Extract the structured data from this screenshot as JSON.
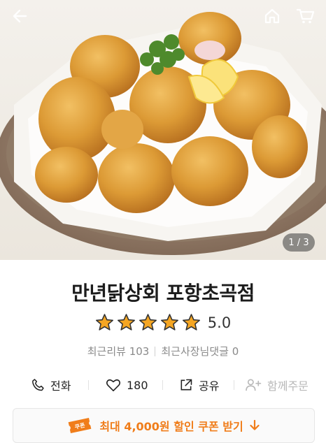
{
  "hero": {
    "pager": "1 / 3"
  },
  "topbar": {
    "icons": [
      "arrow-left-icon",
      "home-icon",
      "cart-icon"
    ]
  },
  "shop": {
    "name": "만년닭상회 포항초곡점",
    "rating_value": "5.0",
    "stars_filled": 5,
    "stars_total": 5,
    "recent_reviews": "최근리뷰 103",
    "owner_replies": "최근사장님댓글 0"
  },
  "actions": {
    "call_label": "전화",
    "like_count": "180",
    "share_label": "공유",
    "group_order_label": "함께주문"
  },
  "coupon": {
    "text": "최대 4,000원 할인 쿠폰 받기",
    "ticket_text": "쿠폰"
  },
  "colors": {
    "star": "#F5A623",
    "coupon_accent": "#F07D1A",
    "disabled": "#B8B8B8"
  }
}
